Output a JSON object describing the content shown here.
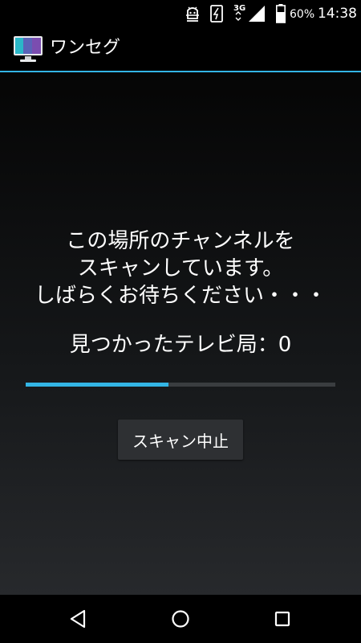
{
  "status_bar": {
    "network_type": "3G",
    "battery_percent": "60%",
    "time": "14:38",
    "icons": [
      "android-debug-icon",
      "screenshot-icon",
      "signal-icon",
      "battery-icon"
    ]
  },
  "app": {
    "title": "ワンセグ",
    "icon": "tv-icon"
  },
  "scan": {
    "message_lines": [
      "この場所のチャンネルを",
      "スキャンしています。",
      "しばらくお待ちください・・・"
    ],
    "found_label": "見つかったテレビ局：",
    "found_count": "0",
    "progress_fraction": 0.46,
    "stop_button_label": "スキャン中止"
  },
  "nav_bar": {
    "icons": [
      "back-icon",
      "home-icon",
      "recents-icon"
    ]
  },
  "colors": {
    "accent": "#33b5e5",
    "button_bg": "#2e3033",
    "progress_track": "#3a3d40"
  }
}
